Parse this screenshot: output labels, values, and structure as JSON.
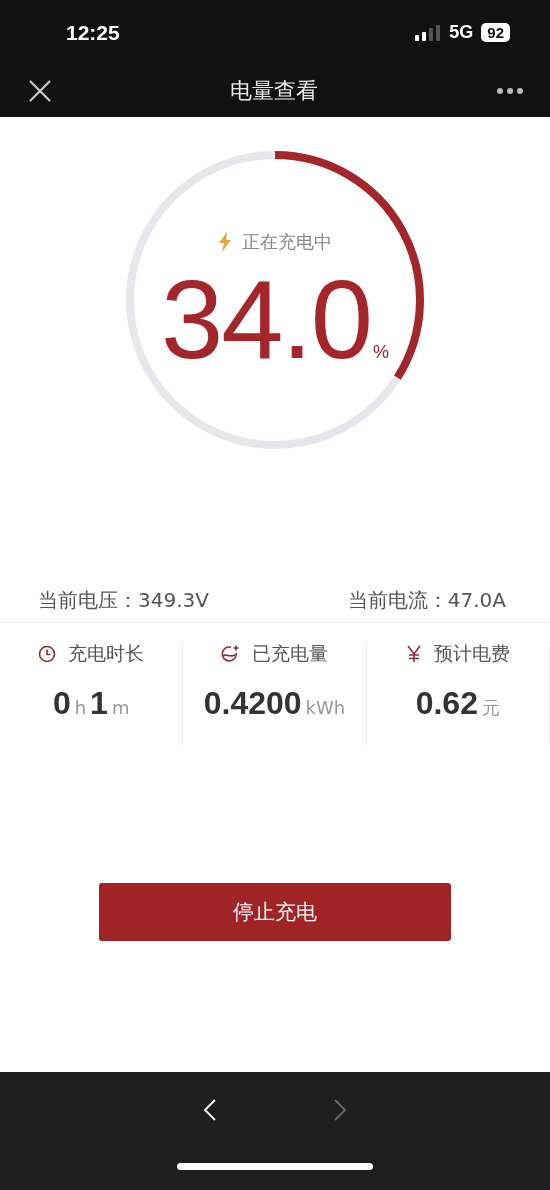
{
  "status_bar": {
    "time": "12:25",
    "network": "5G",
    "battery": "92"
  },
  "nav_bar": {
    "title": "电量查看"
  },
  "gauge": {
    "status": "正在充电中",
    "charging": true,
    "value": "34.0",
    "unit": "%"
  },
  "readings": [
    {
      "label": "当前电压：",
      "value": "349.3V"
    },
    {
      "label": "当前电流：",
      "value": "47.0A"
    }
  ],
  "stats": [
    {
      "kind": "clock",
      "label": "充电时长",
      "parts": [
        {
          "text": "0",
          "kind": "number"
        },
        {
          "text": "h",
          "kind": "unit"
        },
        {
          "text": "1",
          "kind": "number"
        },
        {
          "text": "m",
          "kind": "unit"
        }
      ]
    },
    {
      "kind": "energy",
      "label": "已充电量",
      "parts": [
        {
          "text": "0.4200",
          "kind": "number"
        },
        {
          "text": "kWh",
          "kind": "unit"
        }
      ]
    },
    {
      "kind": "currency",
      "label": "预计电费",
      "parts": [
        {
          "text": "0.62",
          "kind": "number"
        },
        {
          "text": "元",
          "kind": "unit"
        }
      ]
    }
  ],
  "stop_button": {
    "label": "停止充电"
  },
  "browser_nav": {
    "back_disabled": false,
    "forward_disabled": true
  }
}
